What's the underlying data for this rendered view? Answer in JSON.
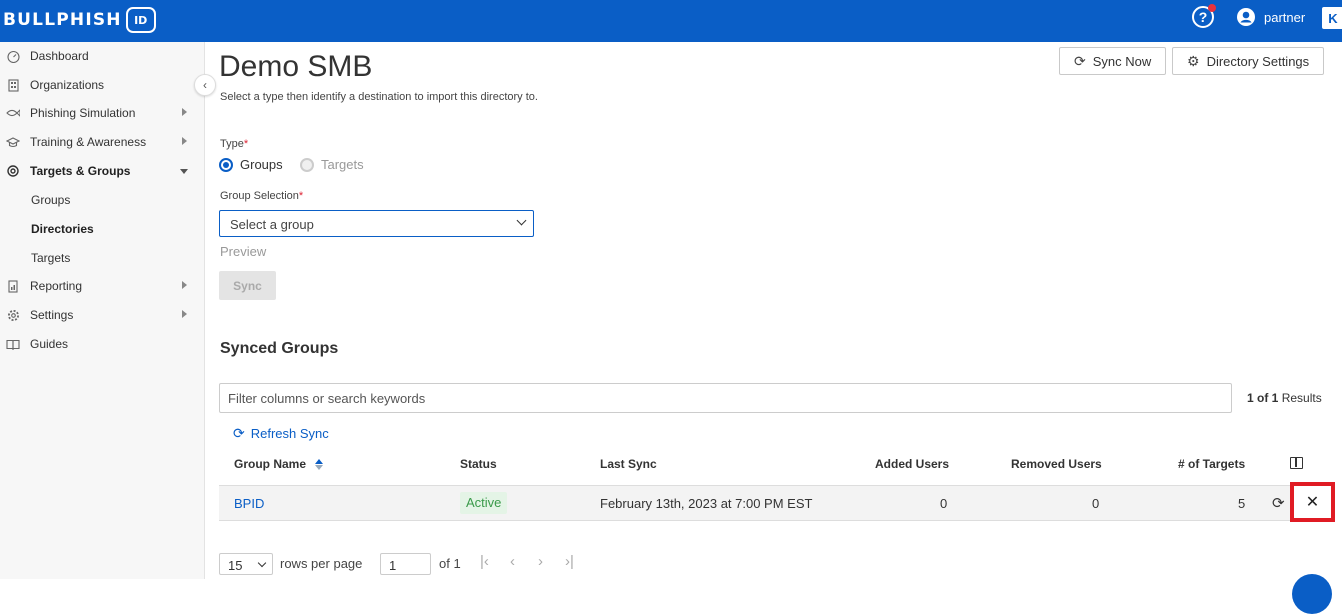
{
  "header": {
    "logo_text": "BULLPHISH",
    "logo_badge": "ID",
    "help_icon": "question-circle-icon",
    "user_label": "partner",
    "corner_icon_text": "K",
    "brand_color": "#0a5ec6"
  },
  "sidebar": {
    "items": [
      {
        "label": "Dashboard",
        "icon": "speedometer-icon"
      },
      {
        "label": "Organizations",
        "icon": "building-icon"
      },
      {
        "label": "Phishing Simulation",
        "icon": "fish-icon"
      },
      {
        "label": "Training & Awareness",
        "icon": "graduation-cap-icon"
      },
      {
        "label": "Targets & Groups",
        "icon": "target-icon"
      },
      {
        "label": "Reporting",
        "icon": "report-icon"
      },
      {
        "label": "Settings",
        "icon": "gear-icon"
      },
      {
        "label": "Guides",
        "icon": "book-icon"
      }
    ],
    "sub_items": [
      {
        "label": "Groups"
      },
      {
        "label": "Directories"
      },
      {
        "label": "Targets"
      }
    ]
  },
  "main": {
    "title": "Demo SMB",
    "subtitle": "Select a type then identify a destination to import this directory to.",
    "sync_now_label": "Sync Now",
    "directory_settings_label": "Directory Settings",
    "type_label": "Type",
    "type_options": [
      "Groups",
      "Targets"
    ],
    "type_selected": "Groups",
    "group_selection_label": "Group Selection",
    "group_select_placeholder": "Select a group",
    "preview_label": "Preview",
    "sync_label": "Sync",
    "synced_groups_title": "Synced Groups",
    "filter_placeholder": "Filter columns or search keywords",
    "results_count": "1 of 1",
    "results_label": "Results",
    "refresh_sync_label": "Refresh Sync"
  },
  "table": {
    "headers": [
      "Group Name",
      "Status",
      "Last Sync",
      "Added Users",
      "Removed Users",
      "# of Targets"
    ],
    "rows": [
      {
        "group_name": "BPID",
        "status": "Active",
        "last_sync": "February 13th, 2023 at 7:00 PM EST",
        "added_users": "0",
        "removed_users": "0",
        "targets": "5"
      }
    ],
    "status_color": "#3a9a4a"
  },
  "pagination": {
    "rows_per_page_value": "15",
    "rows_per_page_label": "rows per page",
    "page_value": "1",
    "of_pages": "of 1"
  }
}
